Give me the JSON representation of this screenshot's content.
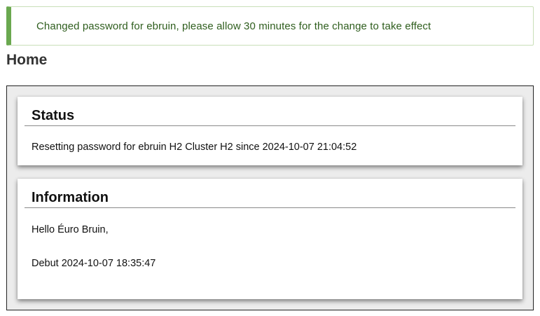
{
  "alert": {
    "message": "Changed password for ebruin, please allow 30 minutes for the change to take effect"
  },
  "page": {
    "title": "Home"
  },
  "status_card": {
    "title": "Status",
    "line": "Resetting password for ebruin H2 Cluster H2 since 2024-10-07 21:04:52"
  },
  "info_card": {
    "title": "Information",
    "greeting": "Hello Éuro Bruin,",
    "debut": "Debut 2024-10-07 18:35:47"
  },
  "colors": {
    "alert_accent": "#6aa84f",
    "alert_text": "#2f5e1e",
    "panel_background": "#ececec"
  }
}
